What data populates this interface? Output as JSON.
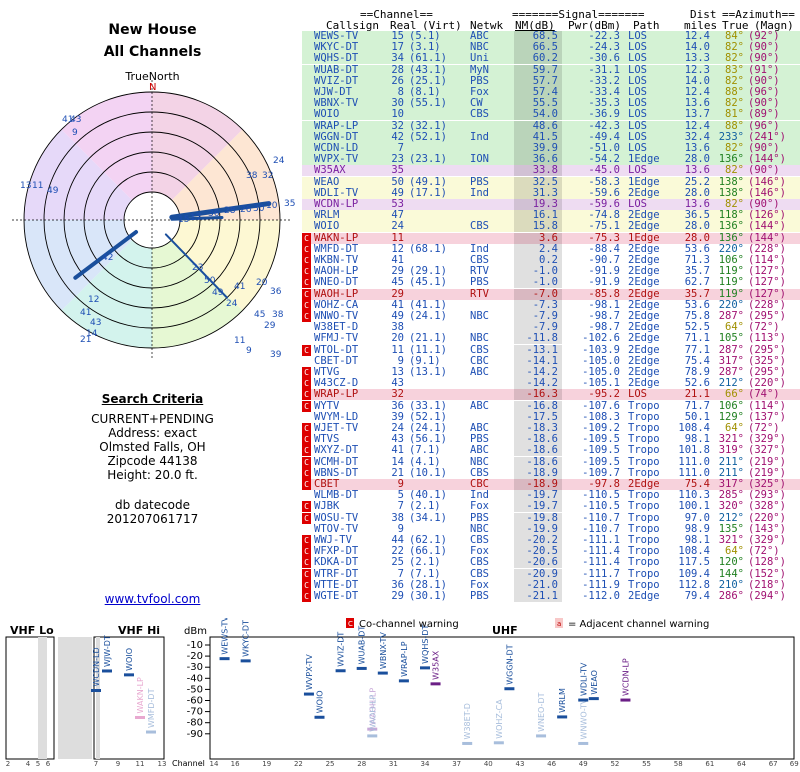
{
  "header": {
    "title1": "New House",
    "title2": "All Channels",
    "true_north": "TrueNorth",
    "north": "N"
  },
  "criteria": {
    "heading": "Search Criteria",
    "lines": [
      "CURRENT+PENDING",
      "Address: exact",
      "Olmsted Falls, OH",
      "Zipcode 44138",
      "Height: 20.0 ft."
    ],
    "db1": "db datecode",
    "db2": "201207061717",
    "link": "www.tvfool.com"
  },
  "table": {
    "group1": "==Channel==",
    "group2": "=======Signal=======",
    "group3": "Dist",
    "group4": "==Azimuth==",
    "col_callsign": "Callsign",
    "col_real": "Real",
    "col_virt": "(Virt)",
    "col_netwk": "Netwk",
    "col_nm": "NM(dB)",
    "col_pwr": "Pwr(dBm)",
    "col_path": "Path",
    "col_miles": "miles",
    "col_true": "True",
    "col_magn": "(Magn)",
    "co_label": "C",
    "adj_label": "a",
    "rows": [
      [
        "WEWS-TV",
        "15",
        "(5.1)",
        "ABC",
        "68.5",
        "-22.3",
        "LOS",
        "12.4",
        "84°",
        "(92°)",
        "g",
        ""
      ],
      [
        "WKYC-DT",
        "17",
        "(3.1)",
        "NBC",
        "66.5",
        "-24.3",
        "LOS",
        "14.0",
        "82°",
        "(90°)",
        "g",
        ""
      ],
      [
        "WQHS-DT",
        "34",
        "(61.1)",
        "Uni",
        "60.2",
        "-30.6",
        "LOS",
        "13.3",
        "82°",
        "(90°)",
        "g",
        ""
      ],
      [
        "WUAB-DT",
        "28",
        "(43.1)",
        "MyN",
        "59.7",
        "-31.1",
        "LOS",
        "12.3",
        "83°",
        "(91°)",
        "g",
        ""
      ],
      [
        "WVIZ-DT",
        "26",
        "(25.1)",
        "PBS",
        "57.7",
        "-33.2",
        "LOS",
        "14.0",
        "82°",
        "(90°)",
        "g",
        ""
      ],
      [
        "WJW-DT",
        "8",
        "(8.1)",
        "Fox",
        "57.4",
        "-33.4",
        "LOS",
        "12.4",
        "88°",
        "(96°)",
        "g",
        ""
      ],
      [
        "WBNX-TV",
        "30",
        "(55.1)",
        "CW",
        "55.5",
        "-35.3",
        "LOS",
        "13.6",
        "82°",
        "(90°)",
        "g",
        ""
      ],
      [
        "WOIO",
        "10",
        "",
        "CBS",
        "54.0",
        "-36.9",
        "LOS",
        "13.7",
        "81°",
        "(89°)",
        "g",
        ""
      ],
      [
        "WRAP-LP",
        "32",
        "(32.1)",
        "",
        "48.6",
        "-42.3",
        "LOS",
        "12.4",
        "88°",
        "(96°)",
        "g",
        ""
      ],
      [
        "WGGN-DT",
        "42",
        "(52.1)",
        "Ind",
        "41.5",
        "-49.4",
        "LOS",
        "32.4",
        "233°",
        "(241°)",
        "g",
        ""
      ],
      [
        "WCDN-LD",
        "7",
        "",
        "",
        "39.9",
        "-51.0",
        "LOS",
        "13.6",
        "82°",
        "(90°)",
        "g",
        ""
      ],
      [
        "WVPX-TV",
        "23",
        "(23.1)",
        "ION",
        "36.6",
        "-54.2",
        "1Edge",
        "28.0",
        "136°",
        "(144°)",
        "g",
        ""
      ],
      [
        "W35AX",
        "35",
        "",
        "",
        "33.8",
        "-45.0",
        "LOS",
        "13.6",
        "82°",
        "(90°)",
        "p",
        ""
      ],
      [
        "WEAO",
        "50",
        "(49.1)",
        "PBS",
        "32.5",
        "-58.3",
        "1Edge",
        "25.2",
        "138°",
        "(146°)",
        "y",
        ""
      ],
      [
        "WDLI-TV",
        "49",
        "(17.1)",
        "Ind",
        "31.3",
        "-59.6",
        "2Edge",
        "28.0",
        "138°",
        "(146°)",
        "y",
        ""
      ],
      [
        "WCDN-LP",
        "53",
        "",
        "",
        "19.3",
        "-59.6",
        "LOS",
        "13.6",
        "82°",
        "(90°)",
        "p",
        ""
      ],
      [
        "WRLM",
        "47",
        "",
        "",
        "16.1",
        "-74.8",
        "2Edge",
        "36.5",
        "118°",
        "(126°)",
        "y",
        ""
      ],
      [
        "WOIO",
        "24",
        "",
        "CBS",
        "15.8",
        "-75.1",
        "2Edge",
        "28.0",
        "136°",
        "(144°)",
        "y",
        ""
      ],
      [
        "WAKN-LP",
        "11",
        "",
        "",
        "3.6",
        "-75.3",
        "1Edge",
        "28.0",
        "136°",
        "(144°)",
        "a",
        "C"
      ],
      [
        "WMFD-DT",
        "12",
        "(68.1)",
        "Ind",
        "2.4",
        "-88.4",
        "2Edge",
        "53.6",
        "220°",
        "(228°)",
        "w",
        "C"
      ],
      [
        "WKBN-TV",
        "41",
        "",
        "CBS",
        "0.2",
        "-90.7",
        "2Edge",
        "71.3",
        "106°",
        "(114°)",
        "w",
        "C"
      ],
      [
        "WAOH-LP",
        "29",
        "(29.1)",
        "RTV",
        "-1.0",
        "-91.9",
        "2Edge",
        "35.7",
        "119°",
        "(127°)",
        "w",
        "C"
      ],
      [
        "WNEO-DT",
        "45",
        "(45.1)",
        "PBS",
        "-1.0",
        "-91.9",
        "2Edge",
        "62.7",
        "119°",
        "(127°)",
        "w",
        "C"
      ],
      [
        "WAOH-LP",
        "29",
        "",
        "RTV",
        "-7.0",
        "-85.8",
        "2Edge",
        "35.7",
        "119°",
        "(127°)",
        "a",
        "C"
      ],
      [
        "WOHZ-CA",
        "41",
        "(41.1)",
        "",
        "-7.3",
        "-98.1",
        "2Edge",
        "53.6",
        "220°",
        "(228°)",
        "w",
        "C"
      ],
      [
        "WNWO-TV",
        "49",
        "(24.1)",
        "NBC",
        "-7.9",
        "-98.7",
        "2Edge",
        "75.8",
        "287°",
        "(295°)",
        "w",
        "C"
      ],
      [
        "W38ET-D",
        "38",
        "",
        "",
        "-7.9",
        "-98.7",
        "2Edge",
        "52.5",
        "64°",
        "(72°)",
        "w",
        ""
      ],
      [
        "WFMJ-TV",
        "20",
        "(21.1)",
        "NBC",
        "-11.8",
        "-102.6",
        "2Edge",
        "71.1",
        "105°",
        "(113°)",
        "w",
        ""
      ],
      [
        "WTOL-DT",
        "11",
        "(11.1)",
        "CBS",
        "-13.1",
        "-103.9",
        "2Edge",
        "77.1",
        "287°",
        "(295°)",
        "w",
        "C"
      ],
      [
        "CBET-DT",
        "9",
        "(9.1)",
        "CBC",
        "-14.1",
        "-105.0",
        "2Edge",
        "75.4",
        "317°",
        "(325°)",
        "w",
        ""
      ],
      [
        "WTVG",
        "13",
        "(13.1)",
        "ABC",
        "-14.2",
        "-105.0",
        "2Edge",
        "78.9",
        "287°",
        "(295°)",
        "w",
        "C"
      ],
      [
        "W43CZ-D",
        "43",
        "",
        "",
        "-14.2",
        "-105.1",
        "2Edge",
        "52.6",
        "212°",
        "(220°)",
        "w",
        "C"
      ],
      [
        "WRAP-LP",
        "32",
        "",
        "",
        "-16.3",
        "-95.2",
        "LOS",
        "21.1",
        "66°",
        "(74°)",
        "a",
        "C"
      ],
      [
        "WYTV",
        "36",
        "(33.1)",
        "ABC",
        "-16.8",
        "-107.6",
        "Tropo",
        "71.7",
        "106°",
        "(114°)",
        "w",
        "C"
      ],
      [
        "WVYM-LD",
        "39",
        "(52.1)",
        "",
        "-17.5",
        "-108.3",
        "Tropo",
        "50.1",
        "129°",
        "(137°)",
        "w",
        ""
      ],
      [
        "WJET-TV",
        "24",
        "(24.1)",
        "ABC",
        "-18.3",
        "-109.2",
        "Tropo",
        "108.4",
        "64°",
        "(72°)",
        "w",
        "C"
      ],
      [
        "WTVS",
        "43",
        "(56.1)",
        "PBS",
        "-18.6",
        "-109.5",
        "Tropo",
        "98.1",
        "321°",
        "(329°)",
        "w",
        "C"
      ],
      [
        "WXYZ-DT",
        "41",
        "(7.1)",
        "ABC",
        "-18.6",
        "-109.5",
        "Tropo",
        "101.8",
        "319°",
        "(327°)",
        "w",
        "C"
      ],
      [
        "WCMH-DT",
        "14",
        "(4.1)",
        "NBC",
        "-18.6",
        "-109.5",
        "Tropo",
        "111.0",
        "211°",
        "(219°)",
        "w",
        "C"
      ],
      [
        "WBNS-DT",
        "21",
        "(10.1)",
        "CBS",
        "-18.9",
        "-109.7",
        "Tropo",
        "111.0",
        "211°",
        "(219°)",
        "w",
        "C"
      ],
      [
        "CBET",
        "9",
        "",
        "CBC",
        "-18.9",
        "-97.8",
        "2Edge",
        "75.4",
        "317°",
        "(325°)",
        "a",
        "C"
      ],
      [
        "WLMB-DT",
        "5",
        "(40.1)",
        "Ind",
        "-19.7",
        "-110.5",
        "Tropo",
        "110.3",
        "285°",
        "(293°)",
        "w",
        ""
      ],
      [
        "WJBK",
        "7",
        "(2.1)",
        "Fox",
        "-19.7",
        "-110.5",
        "Tropo",
        "100.1",
        "320°",
        "(328°)",
        "w",
        "C"
      ],
      [
        "WOSU-TV",
        "38",
        "(34.1)",
        "PBS",
        "-19.8",
        "-110.7",
        "Tropo",
        "97.0",
        "212°",
        "(220°)",
        "w",
        "C"
      ],
      [
        "WTOV-TV",
        "9",
        "",
        "NBC",
        "-19.9",
        "-110.7",
        "Tropo",
        "98.9",
        "135°",
        "(143°)",
        "w",
        ""
      ],
      [
        "WWJ-TV",
        "44",
        "(62.1)",
        "CBS",
        "-20.2",
        "-111.1",
        "Tropo",
        "98.1",
        "321°",
        "(329°)",
        "w",
        "C"
      ],
      [
        "WFXP-DT",
        "22",
        "(66.1)",
        "Fox",
        "-20.5",
        "-111.4",
        "Tropo",
        "108.4",
        "64°",
        "(72°)",
        "w",
        "C"
      ],
      [
        "KDKA-DT",
        "25",
        "(2.1)",
        "CBS",
        "-20.6",
        "-111.4",
        "Tropo",
        "117.5",
        "120°",
        "(128°)",
        "w",
        "C"
      ],
      [
        "WTRF-DT",
        "7",
        "(7.1)",
        "CBS",
        "-20.9",
        "-111.7",
        "Tropo",
        "109.4",
        "144°",
        "(152°)",
        "w",
        "C"
      ],
      [
        "WTTE-DT",
        "36",
        "(28.1)",
        "Fox",
        "-21.0",
        "-111.9",
        "Tropo",
        "112.8",
        "210°",
        "(218°)",
        "w",
        "C"
      ],
      [
        "WGTE-DT",
        "29",
        "(30.1)",
        "PBS",
        "-21.1",
        "-112.0",
        "2Edge",
        "79.4",
        "286°",
        "(294°)",
        "w",
        "C"
      ]
    ]
  },
  "polar": {
    "labels": [
      "43",
      "9",
      "41",
      "13",
      "11",
      "49",
      "24",
      "38",
      "32",
      "15",
      "17",
      "36",
      "28",
      "26",
      "30",
      "10",
      "35",
      "42",
      "23",
      "50",
      "49",
      "24",
      "41",
      "20",
      "36",
      "38",
      "45",
      "29",
      "39",
      "11",
      "9",
      "12",
      "41",
      "43",
      "21",
      "14"
    ]
  },
  "spectrum": {
    "vhf_lo": "VHF Lo",
    "vhf_hi": "VHF Hi",
    "uhf": "UHF",
    "dbm": "dBm",
    "channel": "Channel",
    "legend_co": "Co-channel warning",
    "legend_adj": "= Adjacent channel warning",
    "legend_c": "C",
    "legend_a": "a",
    "ylabels": [
      "-10",
      "-20",
      "-30",
      "-40",
      "-50",
      "-60",
      "-70",
      "-80",
      "-90"
    ],
    "xlabels": [
      "2",
      "4",
      "5",
      "6",
      "7",
      "9",
      "11",
      "13",
      "14",
      "16",
      "19",
      "22",
      "25",
      "28",
      "31",
      "34",
      "37",
      "40",
      "43",
      "46",
      "49",
      "52",
      "55",
      "58",
      "61",
      "64",
      "67",
      "69"
    ],
    "stations": [
      {
        "ch": 15,
        "name": "WEWS-TV",
        "dbm": -22.3,
        "c": "#1a4f9c"
      },
      {
        "ch": 17,
        "name": "WKYC-DT",
        "dbm": -24.3,
        "c": "#1a4f9c"
      },
      {
        "ch": 23,
        "name": "WVPX-TV",
        "dbm": -54.2,
        "c": "#1a4f9c"
      },
      {
        "ch": 24,
        "name": "WOIO",
        "dbm": -75.1,
        "c": "#1a4f9c"
      },
      {
        "ch": 26,
        "name": "WVIZ-DT",
        "dbm": -33.2,
        "c": "#1a4f9c"
      },
      {
        "ch": 28,
        "name": "WUAB-DT",
        "dbm": -31.1,
        "c": "#1a4f9c"
      },
      {
        "ch": 29,
        "name": "WAOH-LP",
        "dbm": -85.8,
        "c": "#c8a8d8"
      },
      {
        "ch": 29,
        "name": "WAOH-LP",
        "dbm": -91.9,
        "c": "#a8bedc"
      },
      {
        "ch": 30,
        "name": "WBNX-TV",
        "dbm": -35.3,
        "c": "#1a4f9c"
      },
      {
        "ch": 32,
        "name": "WRAP-LP",
        "dbm": -42.3,
        "c": "#1a4f9c"
      },
      {
        "ch": 34,
        "name": "WQHS-DT",
        "dbm": -30.6,
        "c": "#1a4f9c"
      },
      {
        "ch": 35,
        "name": "W35AX",
        "dbm": -45.0,
        "c": "#6b1f86"
      },
      {
        "ch": 38,
        "name": "W38ET-D",
        "dbm": -98.7,
        "c": "#a8bedc"
      },
      {
        "ch": 41,
        "name": "WOHZ-CA",
        "dbm": -98.1,
        "c": "#a8bedc"
      },
      {
        "ch": 42,
        "name": "WGGN-DT",
        "dbm": -49.4,
        "c": "#1a4f9c"
      },
      {
        "ch": 45,
        "name": "WNEO-DT",
        "dbm": -91.9,
        "c": "#a8bedc"
      },
      {
        "ch": 47,
        "name": "WRLM",
        "dbm": -74.8,
        "c": "#1a4f9c"
      },
      {
        "ch": 49,
        "name": "WNWO-TV",
        "dbm": -98.7,
        "c": "#a8bedc"
      },
      {
        "ch": 49,
        "name": "WDLI-TV",
        "dbm": -59.6,
        "c": "#1a4f9c"
      },
      {
        "ch": 50,
        "name": "WEAO",
        "dbm": -58.3,
        "c": "#1a4f9c"
      },
      {
        "ch": 53,
        "name": "WCDN-LP",
        "dbm": -59.6,
        "c": "#6b1f86"
      },
      {
        "ch": 7,
        "name": "WCDN-LD",
        "dbm": -51.0,
        "c": "#1a4f9c"
      },
      {
        "ch": 8,
        "name": "WJW-DT",
        "dbm": -33.4,
        "c": "#1a4f9c"
      },
      {
        "ch": 10,
        "name": "WOIO",
        "dbm": -36.9,
        "c": "#1a4f9c"
      },
      {
        "ch": 11,
        "name": "WAKN-LP",
        "dbm": -75.3,
        "c": "#e8a8d0"
      },
      {
        "ch": 12,
        "name": "WMFD-DT",
        "dbm": -88.4,
        "c": "#a8bedc"
      }
    ]
  }
}
